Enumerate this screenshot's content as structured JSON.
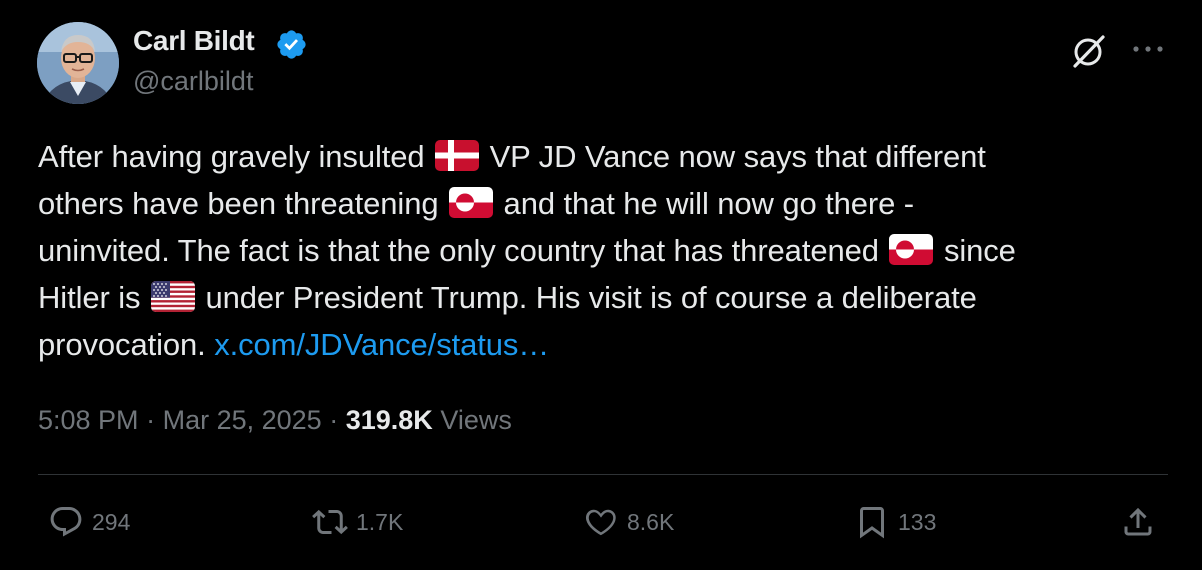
{
  "author": {
    "display_name": "Carl Bildt",
    "handle": "@carlbildt",
    "verified": true
  },
  "header_icons": [
    "grok-icon",
    "more-icon"
  ],
  "tweet": {
    "line1_a": "After having gravely insulted",
    "line1_b": "VP JD Vance now says that different",
    "line2_a": "others have been  threatening",
    "line2_b": "and that he will now go there -",
    "line3_a": "uninvited. The fact is that the only country that has threatened",
    "line3_b": "since",
    "line4_a": "Hitler is",
    "line4_b": "under President Trump. His visit is of course a deliberate",
    "line5_a": "provocation.",
    "link": "x.com/JDVance/status…",
    "flags": [
      "denmark-flag",
      "greenland-flag",
      "greenland-flag",
      "us-flag"
    ]
  },
  "meta": {
    "time": "5:08 PM",
    "separator": "·",
    "date": "Mar 25, 2025",
    "views_count": "319.8K",
    "views_label": "Views"
  },
  "actions": {
    "replies": "294",
    "reposts": "1.7K",
    "likes": "8.6K",
    "bookmarks": "133"
  },
  "colors": {
    "background": "#000000",
    "text": "#e7e9ea",
    "secondary": "#71767b",
    "link": "#1d9bf0",
    "verified": "#1d9bf0",
    "divider": "#2f3336"
  }
}
